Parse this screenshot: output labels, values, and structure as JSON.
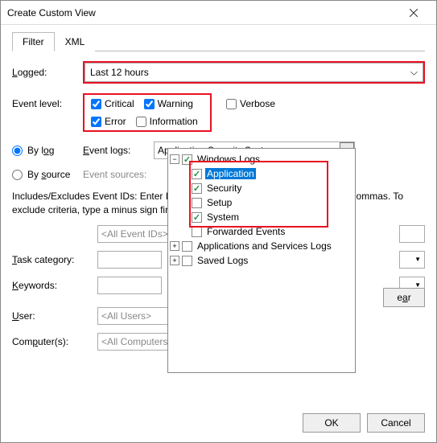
{
  "title": "Create Custom View",
  "tabs": {
    "filter": "Filter",
    "xml": "XML"
  },
  "labels": {
    "logged": "Logged:",
    "eventlevel": "Event level:",
    "bylog": "By log",
    "bysource": "By source",
    "eventlogs": "Event logs:",
    "eventsources": "Event sources:",
    "includes": "Includes/Excludes Event IDs: Enter ID numbers and/or ID ranges separated by commas. To exclude criteria, type a minus sign first. For example 1,3,5-99,-76",
    "task": "Task category:",
    "keywords": "Keywords:",
    "user": "User:",
    "computers": "Computer(s):"
  },
  "logged_value": "Last 12 hours",
  "levels": {
    "critical": "Critical",
    "warning": "Warning",
    "verbose": "Verbose",
    "error": "Error",
    "information": "Information"
  },
  "eventlogs_value": "Application,Security,System",
  "tree": {
    "windows_logs": "Windows Logs",
    "application": "Application",
    "security": "Security",
    "setup": "Setup",
    "system": "System",
    "forwarded": "Forwarded Events",
    "apps_services": "Applications and Services Logs",
    "saved_logs": "Saved Logs"
  },
  "fields": {
    "allids": "<All Event IDs>",
    "allusers": "<All Users>",
    "allcomputers": "<All Computers>"
  },
  "buttons": {
    "clear": "Clear",
    "ok": "OK",
    "cancel": "Cancel"
  }
}
